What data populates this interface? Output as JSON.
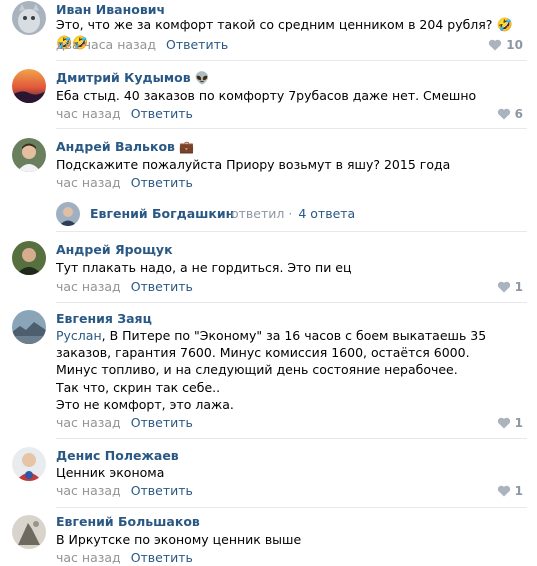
{
  "comments": [
    {
      "author": "Иван Иванович",
      "text": "Это, что же за комфорт такой со средним ценником в 204 рубля?",
      "emoji": "🤣🤣🤣",
      "time": "два часа назад",
      "reply": "Ответить",
      "likes": "10"
    },
    {
      "author": "Дмитрий Кудымов",
      "author_emoji": "👽",
      "text": "Еба      стыд. 40 заказов по комфорту 7рубасов даже нет. Смешно",
      "time": "час назад",
      "reply": "Ответить",
      "likes": "6"
    },
    {
      "author": "Андрей Вальков",
      "author_emoji": "💼",
      "text": "Подскажите пожалуйста Приору возьмут в яшу? 2015 года",
      "time": "час назад",
      "reply": "Ответить",
      "likes": ""
    },
    {
      "author": "Андрей Ярощук",
      "text": "Тут плакать надо, а не гордиться. Это пи      ец",
      "time": "час назад",
      "reply": "Ответить",
      "likes": "1"
    },
    {
      "author": "Евгения Заяц",
      "mention": "Руслан",
      "text": ", В Питере по \"Экономy\" за 16 часов с боем выкатаешь 35 заказов, гарантия 7600. Минус комиссия 1600, остаётся 6000.\nМинус топливо, и на следующий день состояние нерабочее.\nТак что, скрин так себе..\nЭто не комфорт, это лажа.",
      "time": "час назад",
      "reply": "Ответить",
      "likes": "1"
    },
    {
      "author": "Денис Полежаев",
      "text": "Ценник эконома",
      "time": "час назад",
      "reply": "Ответить",
      "likes": "1"
    },
    {
      "author": "Евгений Большаков",
      "text": "В Иркутске по эконому ценник выше",
      "time": "час назад",
      "reply": "Ответить",
      "likes": ""
    }
  ],
  "thread": {
    "name": "Евгений Богдашкин",
    "action": "ответил",
    "separator": "·",
    "count": "4 ответа"
  }
}
